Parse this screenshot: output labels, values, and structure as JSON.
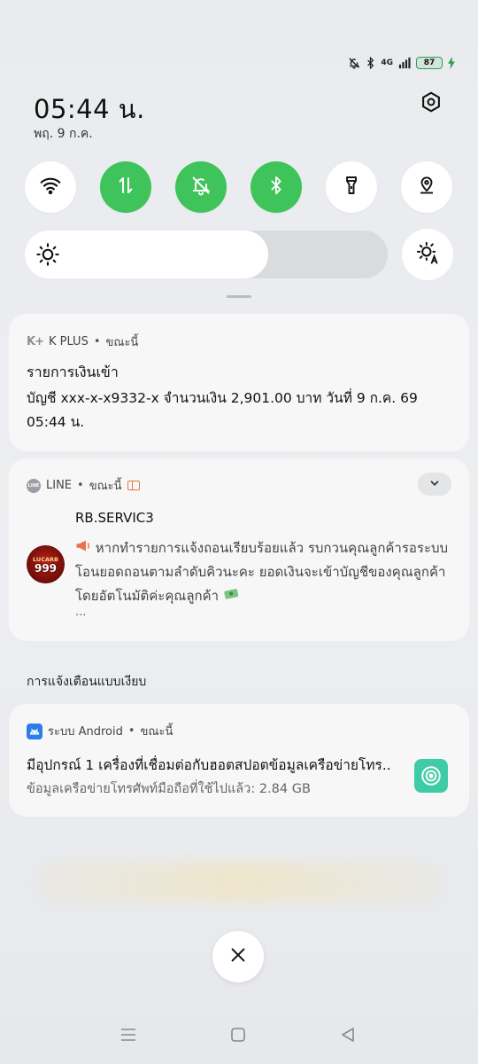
{
  "status_bar": {
    "icons": [
      "mute-icon",
      "bluetooth-icon",
      "signal-icon"
    ],
    "network": "4G",
    "battery": "87"
  },
  "clock": {
    "time": "05:44 น.",
    "date": "พฤ. 9 ก.ค."
  },
  "quick_toggles": [
    {
      "name": "wifi",
      "icon": "wifi-icon",
      "on": false
    },
    {
      "name": "mobile-data",
      "icon": "data-arrows-icon",
      "on": true
    },
    {
      "name": "silent",
      "icon": "bell-off-icon",
      "on": true
    },
    {
      "name": "bluetooth",
      "icon": "bluetooth-icon",
      "on": true
    },
    {
      "name": "flashlight",
      "icon": "flashlight-icon",
      "on": false
    },
    {
      "name": "location",
      "icon": "location-icon",
      "on": false
    }
  ],
  "brightness": {
    "level": 0.67,
    "icon": "sun-icon",
    "auto_icon": "auto-brightness-icon"
  },
  "notifications": {
    "kplus": {
      "logo": "K+",
      "app": "K PLUS",
      "time": "ขณะนี้",
      "title": "รายการเงินเข้า",
      "body": "บัญชี xxx-x-x9332-x  จำนวนเงิน 2,901.00 บาท  วันที่ 9 ก.ค. 69  05:44 น."
    },
    "line": {
      "logo": "LINE",
      "app": "LINE",
      "time": "ขณะนี้",
      "sender": "RB.SERVIC3",
      "avatar_top": "LUCARB",
      "avatar_bottom": "999",
      "body": "หากทำรายการแจ้งถอนเรียบร้อยแล้ว รบกวนคุณลูกค้ารอระบบโอนยอดถอนตามลำดับคิวนะคะ ยอดเงินจะเข้าบัญชีของคุณลูกค้าโดยอัตโนมัติค่ะคุณลูกค้า",
      "more": "..."
    },
    "silent_section": "การแจ้งเตือนแบบเงียบ",
    "android": {
      "app": "ระบบ Android",
      "time": "ขณะนี้",
      "title": "มีอุปกรณ์ 1 เครื่องที่เชื่อมต่อกับฮอตสปอตข้อมูลเครือข่ายโทร..",
      "body": "ข้อมูลเครือข่ายโทรศัพท์มือถือที่ใช้ไปแล้ว: 2.84 GB"
    }
  },
  "nav_bar": [
    "menu-icon",
    "home-icon",
    "back-icon"
  ]
}
